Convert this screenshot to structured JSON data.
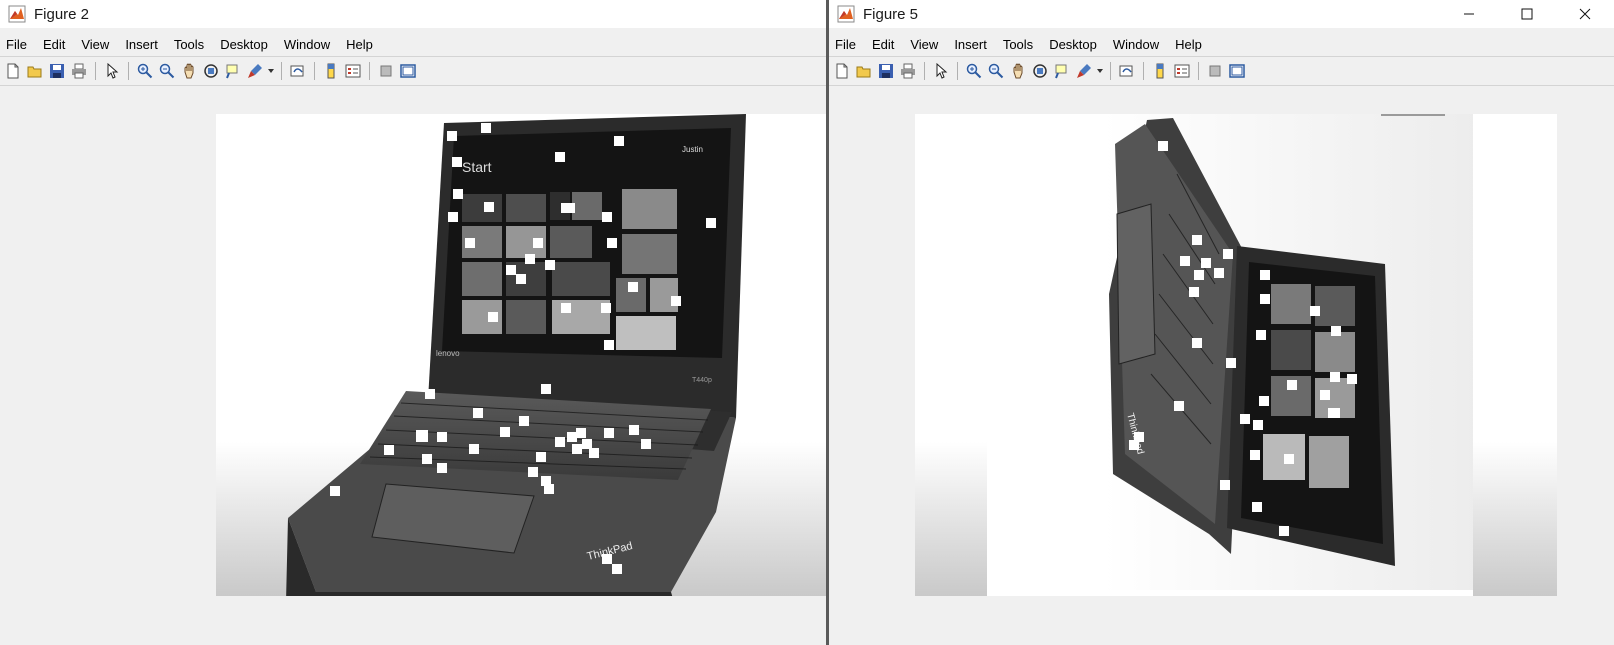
{
  "windows": [
    {
      "title": "Figure 2",
      "menu": [
        "File",
        "Edit",
        "View",
        "Insert",
        "Tools",
        "Desktop",
        "Window",
        "Help"
      ]
    },
    {
      "title": "Figure 5",
      "menu": [
        "File",
        "Edit",
        "View",
        "Insert",
        "Tools",
        "Desktop",
        "Window",
        "Help"
      ]
    }
  ],
  "laptop_screen": {
    "start_label": "Start",
    "user_name": "Justin",
    "brand": "lenovo",
    "model": "T440p",
    "thinkpad_label": "ThinkPad"
  },
  "toolbar_icons": [
    "new-figure-icon",
    "open-file-icon",
    "save-icon",
    "print-icon",
    "pointer-icon",
    "zoom-in-icon",
    "zoom-out-icon",
    "pan-icon",
    "rotate-3d-icon",
    "data-cursor-icon",
    "brush-icon",
    "link-plot-icon",
    "colorbar-icon",
    "legend-icon",
    "hide-plot-tools-icon",
    "show-plot-tools-icon"
  ],
  "colors": {
    "window_bg": "#f0f0f0",
    "titlebar_bg": "#ffffff",
    "divider": "#5a5a5a",
    "noise": "#ffffff"
  }
}
